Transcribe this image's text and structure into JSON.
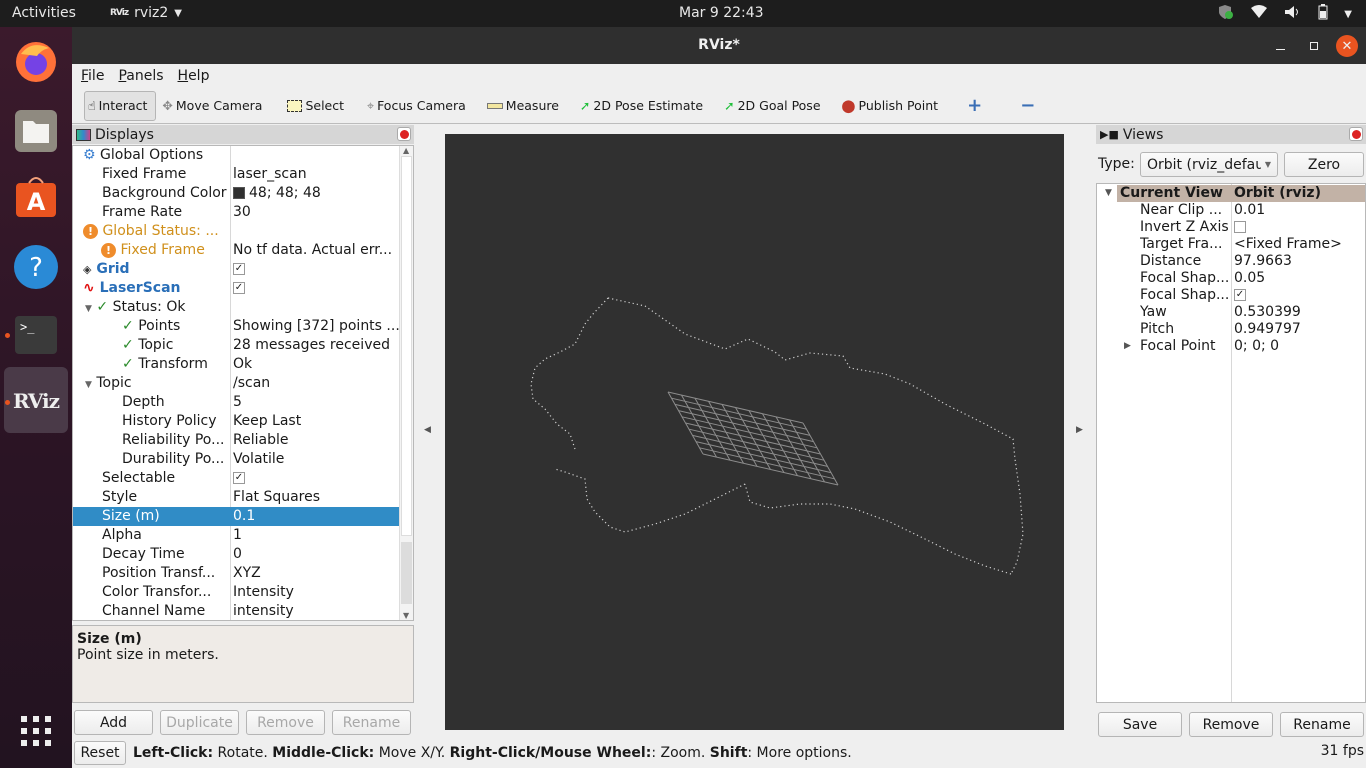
{
  "topbar": {
    "activities": "Activities",
    "app_name": "rviz2",
    "app_logo": "RViz",
    "clock": "Mar 9  22:43",
    "tray_icons": [
      "shield-icon",
      "wifi-icon",
      "volume-icon",
      "battery-icon",
      "system-menu-arrow-icon"
    ]
  },
  "dock": {
    "items": [
      {
        "name": "firefox",
        "icon": "firefox-icon",
        "running": false
      },
      {
        "name": "files",
        "icon": "files-icon",
        "running": false
      },
      {
        "name": "software",
        "icon": "app-store-icon",
        "running": false
      },
      {
        "name": "help",
        "icon": "help-icon",
        "running": false
      },
      {
        "name": "terminal",
        "icon": "terminal-icon",
        "running": true
      },
      {
        "name": "rviz",
        "icon": "rviz-icon",
        "running": true,
        "label": "RViz"
      }
    ],
    "apps_grid": "show-apps-icon"
  },
  "window": {
    "title": "RViz*",
    "controls": {
      "minimize": "—",
      "maximize": "◻",
      "close": "✕"
    }
  },
  "menu": {
    "items": [
      {
        "label": "File",
        "mnemonic": "F",
        "rest": "ile"
      },
      {
        "label": "Panels",
        "mnemonic": "P",
        "rest": "anels"
      },
      {
        "label": "Help",
        "mnemonic": "H",
        "rest": "elp"
      }
    ]
  },
  "toolbar": {
    "tools": [
      {
        "label": "Interact",
        "icon": "hand-pointer-icon",
        "active": true
      },
      {
        "label": "Move Camera",
        "icon": "move-camera-icon",
        "active": false
      },
      {
        "label": "Select",
        "icon": "select-rect-icon",
        "active": false
      },
      {
        "label": "Focus Camera",
        "icon": "focus-camera-icon",
        "active": false
      },
      {
        "label": "Measure",
        "icon": "ruler-icon",
        "active": false
      },
      {
        "label": "2D Pose Estimate",
        "icon": "pose-arrow-icon",
        "active": false
      },
      {
        "label": "2D Goal Pose",
        "icon": "goal-arrow-icon",
        "active": false
      },
      {
        "label": "Publish Point",
        "icon": "map-pin-icon",
        "active": false
      }
    ],
    "add_tool": "+",
    "remove_tool": "−"
  },
  "displays": {
    "title": "Displays",
    "rows": [
      {
        "key": "Global Options",
        "value": "",
        "indent": 0,
        "icon": "gear-icon",
        "style": "normal"
      },
      {
        "key": "Fixed Frame",
        "value": "laser_scan",
        "indent": 1,
        "style": "normal"
      },
      {
        "key": "Background Color",
        "value": "48; 48; 48",
        "indent": 1,
        "style": "normal",
        "swatch": "#303030"
      },
      {
        "key": "Frame Rate",
        "value": "30",
        "indent": 1,
        "style": "normal"
      },
      {
        "key": "Global Status: ...",
        "value": "",
        "indent": 0,
        "icon": "warning-icon",
        "style": "warn"
      },
      {
        "key": "Fixed Frame",
        "value": "No tf data.  Actual err...",
        "indent": 1,
        "icon": "warning-icon",
        "style": "warn"
      },
      {
        "key": "Grid",
        "value": "",
        "indent": 0,
        "icon": "grid-icon",
        "style": "display",
        "checked": true
      },
      {
        "key": "LaserScan",
        "value": "",
        "indent": 0,
        "icon": "laser-scan-icon",
        "style": "display",
        "checked": true
      },
      {
        "key": "Status: Ok",
        "value": "",
        "indent": 1,
        "icon": "check-icon",
        "expander": true,
        "style": "normal"
      },
      {
        "key": "Points",
        "value": "Showing [372] points ...",
        "indent": 2,
        "icon": "check-icon",
        "style": "normal"
      },
      {
        "key": "Topic",
        "value": "28 messages received",
        "indent": 2,
        "icon": "check-icon",
        "style": "normal"
      },
      {
        "key": "Transform",
        "value": "Ok",
        "indent": 2,
        "icon": "check-icon",
        "style": "normal"
      },
      {
        "key": "Topic",
        "value": "/scan",
        "indent": 1,
        "expander": true,
        "style": "normal"
      },
      {
        "key": "Depth",
        "value": "5",
        "indent": 2,
        "style": "normal"
      },
      {
        "key": "History Policy",
        "value": "Keep Last",
        "indent": 2,
        "style": "normal"
      },
      {
        "key": "Reliability Po...",
        "value": "Reliable",
        "indent": 2,
        "style": "normal"
      },
      {
        "key": "Durability Po...",
        "value": "Volatile",
        "indent": 2,
        "style": "normal"
      },
      {
        "key": "Selectable",
        "value": "",
        "indent": 1,
        "style": "normal",
        "checked": true
      },
      {
        "key": "Style",
        "value": "Flat Squares",
        "indent": 1,
        "style": "normal"
      },
      {
        "key": "Size (m)",
        "value": "0.1",
        "indent": 1,
        "style": "normal",
        "selected": true
      },
      {
        "key": "Alpha",
        "value": "1",
        "indent": 1,
        "style": "normal"
      },
      {
        "key": "Decay Time",
        "value": "0",
        "indent": 1,
        "style": "normal"
      },
      {
        "key": "Position Transf...",
        "value": "XYZ",
        "indent": 1,
        "style": "normal"
      },
      {
        "key": "Color Transfor...",
        "value": "Intensity",
        "indent": 1,
        "style": "normal"
      },
      {
        "key": "Channel Name",
        "value": "intensity",
        "indent": 1,
        "style": "normal"
      }
    ],
    "description": {
      "title": "Size (m)",
      "text": "Point size in meters."
    },
    "buttons": {
      "add": "Add",
      "duplicate": "Duplicate",
      "remove": "Remove",
      "rename": "Rename"
    }
  },
  "views": {
    "title": "Views",
    "type_label": "Type:",
    "type_value": "Orbit (rviz_defau",
    "zero": "Zero",
    "header": {
      "key": "Current View",
      "value": "Orbit (rviz)"
    },
    "rows": [
      {
        "key": "Near Clip ...",
        "value": "0.01"
      },
      {
        "key": "Invert Z Axis",
        "value": "",
        "checkbox": false
      },
      {
        "key": "Target Fra...",
        "value": "<Fixed Frame>"
      },
      {
        "key": "Distance",
        "value": "97.9663"
      },
      {
        "key": "Focal Shap...",
        "value": "0.05"
      },
      {
        "key": "Focal Shap...",
        "value": "",
        "checkbox": true
      },
      {
        "key": "Yaw",
        "value": "0.530399"
      },
      {
        "key": "Pitch",
        "value": "0.949797"
      },
      {
        "key": "Focal Point",
        "value": "0; 0; 0",
        "expander": true
      }
    ],
    "buttons": {
      "save": "Save",
      "remove": "Remove",
      "rename": "Rename"
    }
  },
  "statusbar": {
    "reset": "Reset",
    "hint": [
      {
        "b": "Left-Click:",
        "t": " Rotate. "
      },
      {
        "b": "Middle-Click:",
        "t": " Move X/Y. "
      },
      {
        "b": "Right-Click/Mouse Wheel:",
        "t": ": Zoom. "
      },
      {
        "b": "Shift",
        "t": ": More options."
      }
    ],
    "fps": "31 fps"
  },
  "colors": {
    "accent_selection": "#308cc6",
    "warning": "#d0901c",
    "display_name": "#2a6fb8",
    "background": "#303030",
    "ubuntu_orange": "#e95420"
  }
}
